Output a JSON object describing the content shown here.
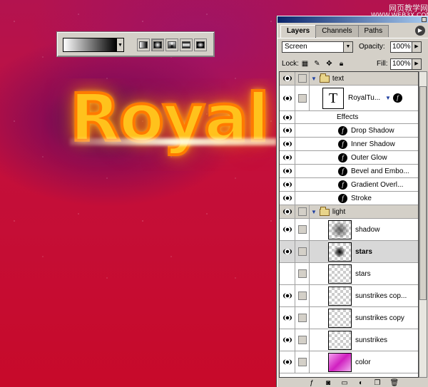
{
  "canvas": {
    "headline": "Royal"
  },
  "watermark": {
    "line1": "网页教学网",
    "line2": "WWW.WEB3X.COM"
  },
  "gradient_toolbar": {
    "dropdown_arrow": "▼",
    "types": [
      "linear",
      "radial",
      "angle",
      "reflected",
      "diamond"
    ],
    "active_type_index": 1
  },
  "palette": {
    "tabs": [
      {
        "label": "Layers",
        "active": true
      },
      {
        "label": "Channels",
        "active": false
      },
      {
        "label": "Paths",
        "active": false
      }
    ],
    "menu_icon": "▶",
    "blend_mode": "Screen",
    "opacity_label": "Opacity:",
    "opacity_value": "100%",
    "lock_label": "Lock:",
    "fill_label": "Fill:",
    "fill_value": "100%",
    "layers": {
      "group_text": "text",
      "type_layer": "RoyalTu...",
      "effects_label": "Effects",
      "effects": [
        "Drop Shadow",
        "Inner Shadow",
        "Outer Glow",
        "Bevel and Embo...",
        "Gradient Overl...",
        "Stroke"
      ],
      "group_light": "light",
      "pixel_layers": [
        {
          "name": "shadow",
          "visible": true,
          "selected": false,
          "bold": false
        },
        {
          "name": "stars",
          "visible": true,
          "selected": true,
          "bold": true
        },
        {
          "name": "stars",
          "visible": false,
          "selected": false,
          "bold": false
        },
        {
          "name": "sunstrikes cop...",
          "visible": true,
          "selected": false,
          "bold": false
        },
        {
          "name": "sunstrikes copy",
          "visible": true,
          "selected": false,
          "bold": false
        },
        {
          "name": "sunstrikes",
          "visible": true,
          "selected": false,
          "bold": false
        },
        {
          "name": "color",
          "visible": true,
          "selected": false,
          "bold": false
        }
      ]
    },
    "type_thumb_glyph": "T",
    "fx_glyph": "f",
    "bottom_icons": [
      "add-layer-style-icon",
      "add-mask-icon",
      "new-set-icon",
      "new-fill-layer-icon",
      "new-layer-icon",
      "trash-icon"
    ]
  }
}
